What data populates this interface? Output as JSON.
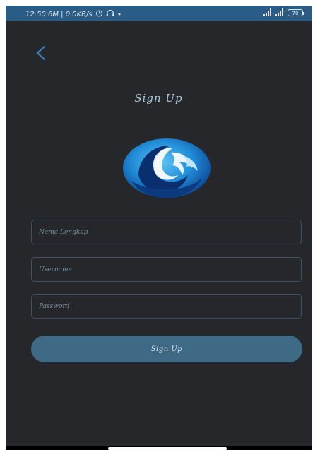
{
  "status_bar": {
    "left_text": "12:50 6M | 0.0KB/s",
    "battery": "78",
    "icons": [
      "alarm-icon",
      "headphones-icon",
      "dot-icon",
      "signal-icon",
      "signal-icon",
      "battery-icon"
    ]
  },
  "header": {
    "back_icon": "chevron-left-icon",
    "title": "Sign Up"
  },
  "logo": {
    "icon": "wave-logo-icon"
  },
  "form": {
    "name_placeholder": "Nama Lengkap",
    "username_placeholder": "Username",
    "password_placeholder": "Password",
    "submit_label": "Sign Up"
  },
  "colors": {
    "background": "#25272a",
    "status_bar": "#2b5c86",
    "accent": "#3f6a86",
    "logo_blue": "#1f8ad6",
    "logo_dark": "#0d3f8c"
  }
}
